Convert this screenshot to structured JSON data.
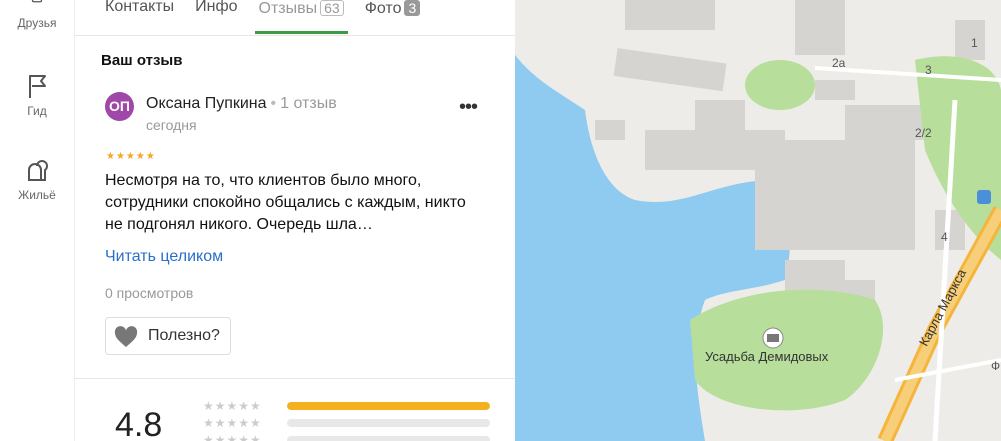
{
  "rail": {
    "items": [
      {
        "label": "Друзья",
        "icon": "friends-icon"
      },
      {
        "label": "Гид",
        "icon": "flag-icon"
      },
      {
        "label": "Жильё",
        "icon": "housing-icon"
      }
    ]
  },
  "tabs": [
    {
      "label": "Контакты"
    },
    {
      "label": "Инфо"
    },
    {
      "label": "Отзывы",
      "count": "63"
    },
    {
      "label": "Фото",
      "count": "3"
    }
  ],
  "review_section": {
    "title": "Ваш отзыв",
    "avatar_initials": "ОП",
    "avatar_color": "#a048a8",
    "author": "Оксана Пупкина",
    "review_count": "1 отзыв",
    "date": "сегодня",
    "more_icon": "more-dots-icon",
    "stars": "★★★★★",
    "star_rating": 5,
    "text": "Несмотря на то, что клиентов было много, сотрудники спокойно общались с каждым, никто не подгонял никого. Очередь шла…",
    "read_more": "Читать целиком",
    "views": "0 просмотров",
    "useful_label": "Полезно?"
  },
  "summary": {
    "rating": "4.8",
    "distribution": [
      {
        "stars": "★★★★★",
        "fraction": 1.0
      },
      {
        "stars": "★★★★★",
        "fraction": 0.0
      },
      {
        "stars": "★★★★★",
        "fraction": 0.0
      }
    ],
    "bar_color": "#f3b21d"
  },
  "map": {
    "labels": {
      "estate": "Усадьба Демидовых",
      "street": "Карла Маркса",
      "house_2a": "2а",
      "house_22": "2/2",
      "house_4": "4",
      "house_3": "3",
      "house_1": "1",
      "street_f": "Ф"
    },
    "water_color": "#8fcbf0",
    "park_color": "#b7de9a",
    "road_color": "#f5b53a"
  }
}
